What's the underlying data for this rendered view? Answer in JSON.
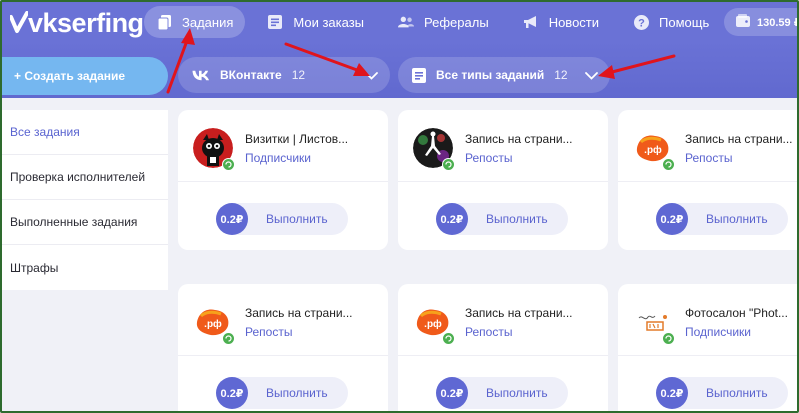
{
  "brand": {
    "logo_text": "vkserfing"
  },
  "nav": [
    {
      "label": "Задания",
      "icon": "document-icon",
      "active": true
    },
    {
      "label": "Мои заказы",
      "icon": "list-icon",
      "active": false
    },
    {
      "label": "Рефералы",
      "icon": "users-icon",
      "active": false
    },
    {
      "label": "Новости",
      "icon": "megaphone-icon",
      "active": false
    },
    {
      "label": "Помощь",
      "icon": "question-icon",
      "active": false
    }
  ],
  "balance": {
    "value": "130.59 ₽",
    "icon": "wallet-icon"
  },
  "create_button": {
    "label": "+ Создать задание"
  },
  "filters": {
    "network": {
      "label": "ВКонтакте",
      "count": "12",
      "icon": "vk-icon"
    },
    "types": {
      "label": "Все типы заданий",
      "count": "12",
      "icon": "document-icon"
    }
  },
  "sidebar": {
    "items": [
      {
        "label": "Все задания",
        "active": true
      },
      {
        "label": "Проверка исполнителей",
        "active": false
      },
      {
        "label": "Выполненные задания",
        "active": false
      },
      {
        "label": "Штрафы",
        "active": false
      }
    ]
  },
  "cards": [
    {
      "title": "Визитки | Листов...",
      "type": "Подписчики",
      "price": "0.2₽",
      "action": "Выполнить",
      "avatar": "cat-avatar"
    },
    {
      "title": "Запись на страни...",
      "type": "Репосты",
      "price": "0.2₽",
      "action": "Выполнить",
      "avatar": "dancer-avatar"
    },
    {
      "title": "Запись на страни...",
      "type": "Репосты",
      "price": "0.2₽",
      "action": "Выполнить",
      "avatar": "rf-avatar"
    },
    {
      "title": "Запись на страни...",
      "type": "Репосты",
      "price": "0.2₽",
      "action": "Выполнить",
      "avatar": "rf-avatar"
    },
    {
      "title": "Запись на страни...",
      "type": "Репосты",
      "price": "0.2₽",
      "action": "Выполнить",
      "avatar": "rf-avatar"
    },
    {
      "title": "Фотосалон \"Phot...",
      "type": "Подписчики",
      "price": "0.2₽",
      "action": "Выполнить",
      "avatar": "photo-salon-avatar"
    }
  ],
  "colors": {
    "accent": "#6a72d6",
    "link": "#5a63cf",
    "create_button": "#75b7f0",
    "annotation_arrow": "#e0141c"
  }
}
